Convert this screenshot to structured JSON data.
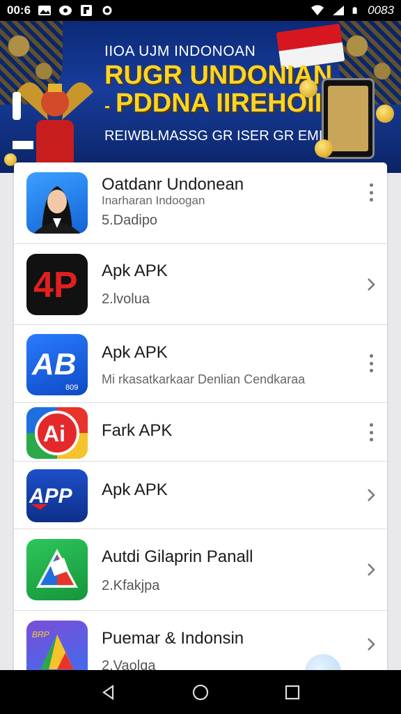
{
  "status_bar": {
    "time": "00:6",
    "right_text": "0083",
    "left_icons": [
      "image-icon",
      "chat-icon",
      "flipboard-icon",
      "settings-icon"
    ],
    "right_icons": [
      "wifi-icon",
      "signal-icon",
      "battery-icon"
    ]
  },
  "banner": {
    "line1": "IIOA UJM INDONOAN",
    "line2a": "RUGR UNDONIAN",
    "line2b": "PDDNA IIREHOIIA",
    "line2b_prefix": "-",
    "line3": "REIWBLMASSG GR ISER GR EMIMA",
    "flag_colors": [
      "#d7171f",
      "#f3f3f3"
    ]
  },
  "apps": [
    {
      "title": "Oatdanr Undonean",
      "subtitle": "Inarharan Indoogan",
      "meta": "5.Dadipo",
      "action": "more-vert-icon",
      "icon": "app-icon-avatar"
    },
    {
      "title": "Apk APK",
      "subtitle": "",
      "meta": "2.lvolua",
      "action": "chevron-right-icon",
      "icon": "app-icon-4p"
    },
    {
      "title": "Apk APK",
      "subtitle": "Mi rkasatkarkaar Denlian Cendkaraa",
      "meta": "",
      "action": "more-vert-icon",
      "icon": "app-icon-ab"
    },
    {
      "title": "Fark APK",
      "subtitle": "",
      "meta": "",
      "action": "more-vert-icon",
      "icon": "app-icon-ai"
    },
    {
      "title": "Apk APK",
      "subtitle": "",
      "meta": "",
      "action": "chevron-right-icon",
      "icon": "app-icon-app"
    },
    {
      "title": "Autdi Gilaprin Panall",
      "subtitle": "",
      "meta": "2.Kfakjpa",
      "action": "chevron-right-icon",
      "icon": "app-icon-green"
    },
    {
      "title": "Puemar & Indonsin",
      "subtitle": "",
      "meta": "2.Vaolqa",
      "action": "chevron-right-icon",
      "icon": "app-icon-drive"
    }
  ],
  "app_icon_labels": {
    "p4": "4P",
    "ab": "AB",
    "ai": "Ai",
    "app": "APP",
    "ab_small": "809",
    "drive_small": "BRP"
  },
  "nav": {
    "back": "back-icon",
    "home": "home-icon",
    "recents": "recents-icon"
  },
  "colors": {
    "status_bg": "#000000",
    "banner_bg": "#173c9a",
    "banner_accent": "#ffd423",
    "list_bg": "#ffffff",
    "nav_bg": "#000000"
  }
}
